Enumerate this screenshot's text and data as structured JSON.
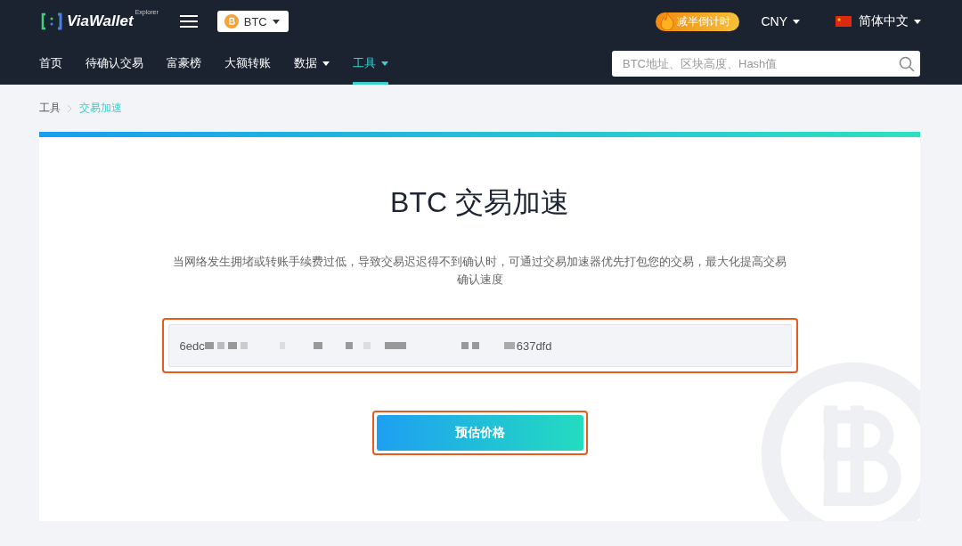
{
  "header": {
    "logo": {
      "name": "ViaWallet",
      "tag": "Explorer"
    },
    "coin_select": {
      "label": "BTC"
    },
    "badge": {
      "label": "减半倒计时"
    },
    "currency": {
      "label": "CNY"
    },
    "language": {
      "label": "简体中文"
    }
  },
  "nav": {
    "items": [
      {
        "label": "首页",
        "selected": false,
        "dropdown": false
      },
      {
        "label": "待确认交易",
        "selected": false,
        "dropdown": false
      },
      {
        "label": "富豪榜",
        "selected": false,
        "dropdown": false
      },
      {
        "label": "大额转账",
        "selected": false,
        "dropdown": false
      },
      {
        "label": "数据",
        "selected": false,
        "dropdown": true
      },
      {
        "label": "工具",
        "selected": true,
        "dropdown": true
      }
    ],
    "search": {
      "placeholder": "BTC地址、区块高度、Hash值"
    }
  },
  "breadcrumb": [
    {
      "label": "工具",
      "selected": false
    },
    {
      "label": "交易加速",
      "selected": true
    }
  ],
  "card": {
    "title": "BTC 交易加速",
    "description": "当网络发生拥堵或转账手续费过低，导致交易迟迟得不到确认时，可通过交易加速器优先打包您的交易，最大化提高交易确认速度",
    "tx_field": {
      "value_start": "6edc",
      "value_end": "637dfd",
      "redacted": true,
      "highlighted": true
    },
    "button": {
      "label": "预估价格",
      "highlighted": true
    }
  }
}
